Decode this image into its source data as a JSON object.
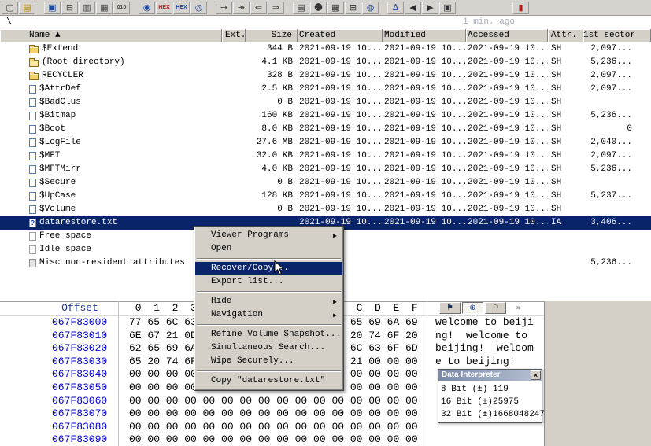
{
  "toolbar": {
    "buttons": [
      {
        "n": "new-file-button",
        "g": "▢",
        "cls": "",
        "it": "true"
      },
      {
        "n": "open-folder-button",
        "g": "▤",
        "cls": "gold",
        "it": "true"
      },
      {
        "n": "toolbar-gap",
        "g": "",
        "cls": "gap",
        "it": "false"
      },
      {
        "n": "save-button",
        "g": "▣",
        "cls": "blue",
        "it": "true"
      },
      {
        "n": "copy-button",
        "g": "⊟",
        "cls": "",
        "it": "true"
      },
      {
        "n": "paste-button",
        "g": "▥",
        "cls": "",
        "it": "true"
      },
      {
        "n": "paste-into-new-button",
        "g": "▦",
        "cls": "",
        "it": "true"
      },
      {
        "n": "binary-010-button",
        "g": "010",
        "cls": "txt",
        "it": "true"
      },
      {
        "n": "toolbar-gap",
        "g": "",
        "cls": "gap",
        "it": "false"
      },
      {
        "n": "find-text-button",
        "g": "◉",
        "cls": "blue",
        "it": "true"
      },
      {
        "n": "find-hex-button",
        "g": "HEX",
        "cls": "txt red",
        "it": "true"
      },
      {
        "n": "replace-hex-button",
        "g": "HEX",
        "cls": "txt blue",
        "it": "true"
      },
      {
        "n": "find-next-button",
        "g": "◎",
        "cls": "blue",
        "it": "true"
      },
      {
        "n": "toolbar-gap",
        "g": "",
        "cls": "gap",
        "it": "false"
      },
      {
        "n": "goto-offset-button",
        "g": "→",
        "cls": "",
        "it": "true"
      },
      {
        "n": "goto-end-button",
        "g": "↠",
        "cls": "",
        "it": "true"
      },
      {
        "n": "back-button",
        "g": "⇐",
        "cls": "",
        "it": "true"
      },
      {
        "n": "forward-button",
        "g": "⇒",
        "cls": "",
        "it": "true"
      },
      {
        "n": "toolbar-gap",
        "g": "",
        "cls": "gap",
        "it": "false"
      },
      {
        "n": "print-button",
        "g": "▤",
        "cls": "dark",
        "it": "true"
      },
      {
        "n": "users-button",
        "g": "☻",
        "cls": "dark",
        "it": "true"
      },
      {
        "n": "notes-button",
        "g": "▦",
        "cls": "dark",
        "it": "true"
      },
      {
        "n": "calculator-button",
        "g": "⊞",
        "cls": "dark",
        "it": "true"
      },
      {
        "n": "magnifier-button",
        "g": "◍",
        "cls": "blue",
        "it": "true"
      },
      {
        "n": "toolbar-gap",
        "g": "",
        "cls": "gap",
        "it": "false"
      },
      {
        "n": "scales-button",
        "g": "Δ",
        "cls": "blue",
        "it": "true"
      },
      {
        "n": "prev-button",
        "g": "◀",
        "cls": "dark",
        "it": "true"
      },
      {
        "n": "next-button",
        "g": "▶",
        "cls": "dark",
        "it": "true"
      },
      {
        "n": "camera-button",
        "g": "▣",
        "cls": "dark",
        "it": "true"
      },
      {
        "n": "toolbar-gap-wide",
        "g": "",
        "cls": "gapw",
        "it": "false"
      },
      {
        "n": "help-book-button",
        "g": "▮",
        "cls": "red",
        "it": "true"
      }
    ]
  },
  "pathbar": {
    "path": "\\",
    "age_label": "1 min. ago"
  },
  "file_table": {
    "columns": [
      "Name ▲",
      "Ext.",
      "Size",
      "Created",
      "Modified",
      "Accessed",
      "Attr.",
      "1st sector"
    ],
    "rows": [
      {
        "icon_cls": "icon-folder",
        "icon_name": "folder-icon",
        "icon_glyph": "",
        "name": "$Extend",
        "ext": "",
        "size": "344 B",
        "created": "2021-09-19 10...",
        "modified": "2021-09-19 10...",
        "accessed": "2021-09-19 10...",
        "attr": "SH",
        "sector": "2,097...",
        "cls": ""
      },
      {
        "icon_cls": "icon-folder-open",
        "icon_name": "open-folder-icon",
        "icon_glyph": "",
        "name": "(Root directory)",
        "ext": "",
        "size": "4.1 KB",
        "created": "2021-09-19 10...",
        "modified": "2021-09-19 10...",
        "accessed": "2021-09-19 10...",
        "attr": "SH",
        "sector": "5,236...",
        "cls": ""
      },
      {
        "icon_cls": "icon-folder",
        "icon_name": "folder-icon",
        "icon_glyph": "",
        "name": "RECYCLER",
        "ext": "",
        "size": "328 B",
        "created": "2021-09-19 10...",
        "modified": "2021-09-19 10...",
        "accessed": "2021-09-19 10...",
        "attr": "SH",
        "sector": "2,097...",
        "cls": ""
      },
      {
        "icon_cls": "icon-file",
        "icon_name": "system-file-icon",
        "icon_glyph": "",
        "name": "$AttrDef",
        "ext": "",
        "size": "2.5 KB",
        "created": "2021-09-19 10...",
        "modified": "2021-09-19 10...",
        "accessed": "2021-09-19 10...",
        "attr": "SH",
        "sector": "2,097...",
        "cls": ""
      },
      {
        "icon_cls": "icon-file",
        "icon_name": "system-file-icon",
        "icon_glyph": "",
        "name": "$BadClus",
        "ext": "",
        "size": "0 B",
        "created": "2021-09-19 10...",
        "modified": "2021-09-19 10...",
        "accessed": "2021-09-19 10...",
        "attr": "SH",
        "sector": "",
        "cls": ""
      },
      {
        "icon_cls": "icon-file",
        "icon_name": "system-file-icon",
        "icon_glyph": "",
        "name": "$Bitmap",
        "ext": "",
        "size": "160 KB",
        "created": "2021-09-19 10...",
        "modified": "2021-09-19 10...",
        "accessed": "2021-09-19 10...",
        "attr": "SH",
        "sector": "5,236...",
        "cls": ""
      },
      {
        "icon_cls": "icon-file",
        "icon_name": "system-file-icon",
        "icon_glyph": "",
        "name": "$Boot",
        "ext": "",
        "size": "8.0 KB",
        "created": "2021-09-19 10...",
        "modified": "2021-09-19 10...",
        "accessed": "2021-09-19 10...",
        "attr": "SH",
        "sector": "0",
        "cls": ""
      },
      {
        "icon_cls": "icon-file",
        "icon_name": "system-file-icon",
        "icon_glyph": "",
        "name": "$LogFile",
        "ext": "",
        "size": "27.6 MB",
        "created": "2021-09-19 10...",
        "modified": "2021-09-19 10...",
        "accessed": "2021-09-19 10...",
        "attr": "SH",
        "sector": "2,040...",
        "cls": ""
      },
      {
        "icon_cls": "icon-file",
        "icon_name": "system-file-icon",
        "icon_glyph": "",
        "name": "$MFT",
        "ext": "",
        "size": "32.0 KB",
        "created": "2021-09-19 10...",
        "modified": "2021-09-19 10...",
        "accessed": "2021-09-19 10...",
        "attr": "SH",
        "sector": "2,097...",
        "cls": ""
      },
      {
        "icon_cls": "icon-file",
        "icon_name": "system-file-icon",
        "icon_glyph": "",
        "name": "$MFTMirr",
        "ext": "",
        "size": "4.0 KB",
        "created": "2021-09-19 10...",
        "modified": "2021-09-19 10...",
        "accessed": "2021-09-19 10...",
        "attr": "SH",
        "sector": "5,236...",
        "cls": ""
      },
      {
        "icon_cls": "icon-file",
        "icon_name": "system-file-icon",
        "icon_glyph": "",
        "name": "$Secure",
        "ext": "",
        "size": "0 B",
        "created": "2021-09-19 10...",
        "modified": "2021-09-19 10...",
        "accessed": "2021-09-19 10...",
        "attr": "SH",
        "sector": "",
        "cls": ""
      },
      {
        "icon_cls": "icon-file",
        "icon_name": "system-file-icon",
        "icon_glyph": "",
        "name": "$UpCase",
        "ext": "",
        "size": "128 KB",
        "created": "2021-09-19 10...",
        "modified": "2021-09-19 10...",
        "accessed": "2021-09-19 10...",
        "attr": "SH",
        "sector": "5,237...",
        "cls": ""
      },
      {
        "icon_cls": "icon-file",
        "icon_name": "system-file-icon",
        "icon_glyph": "",
        "name": "$Volume",
        "ext": "",
        "size": "0 B",
        "created": "2021-09-19 10...",
        "modified": "2021-09-19 10...",
        "accessed": "2021-09-19 10...",
        "attr": "SH",
        "sector": "",
        "cls": ""
      },
      {
        "icon_cls": "icon-file-del",
        "icon_name": "deleted-file-icon",
        "icon_glyph": "?",
        "name": "datarestore.txt",
        "ext": "",
        "size": "",
        "created": "2021-09-19 10...",
        "modified": "2021-09-19 10...",
        "accessed": "2021-09-19 10...",
        "attr": "IA",
        "sector": "3,406...",
        "cls": "selected"
      },
      {
        "icon_cls": "icon-space",
        "icon_name": "free-space-icon",
        "icon_glyph": "",
        "name": "Free space",
        "ext": "",
        "size": "",
        "created": "",
        "modified": "",
        "accessed": "",
        "attr": "",
        "sector": "",
        "cls": ""
      },
      {
        "icon_cls": "icon-space",
        "icon_name": "idle-space-icon",
        "icon_glyph": "",
        "name": "Idle space",
        "ext": "",
        "size": "",
        "created": "",
        "modified": "",
        "accessed": "",
        "attr": "",
        "sector": "",
        "cls": ""
      },
      {
        "icon_cls": "icon-file-gray",
        "icon_name": "misc-attributes-icon",
        "icon_glyph": "",
        "name": "Misc non-resident attributes",
        "ext": "",
        "size": "",
        "created": "",
        "modified": "",
        "accessed": "",
        "attr": "",
        "sector": "5,236...",
        "cls": ""
      }
    ]
  },
  "context_menu": {
    "submenu_arrow": "▶",
    "items": [
      {
        "label": "Viewer Programs"
      },
      {
        "label": "Open"
      },
      {
        "label": "Recover/Copy..."
      },
      {
        "label": "Export list..."
      },
      {
        "label": "Hide"
      },
      {
        "label": "Navigation"
      },
      {
        "label": "Refine Volume Snapshot..."
      },
      {
        "label": "Simultaneous Search..."
      },
      {
        "label": "Wipe Securely..."
      },
      {
        "label": "Copy \"datarestore.txt\""
      }
    ]
  },
  "hex_panel": {
    "header": {
      "offset_label": "Offset",
      "columns": " 0  1  2  3  4  5  6  7  8  9  A  B  C  D  E  F"
    },
    "rows": [
      {
        "offset": "067F83000",
        "bytes": "77 65 6C 63 6F 6D 65 20 74 6F 20 62 65 69 6A 69",
        "text": "welcome to beiji"
      },
      {
        "offset": "067F83010",
        "bytes": "6E 67 21 0D 0A 77 65 6C 63 6F 6D 65 20 74 6F 20",
        "text": "ng!  welcome to "
      },
      {
        "offset": "067F83020",
        "bytes": "62 65 69 6A 69 6E 67 21 0D 0A 77 65 6C 63 6F 6D",
        "text": "beijing!  welcom"
      },
      {
        "offset": "067F83030",
        "bytes": "65 20 74 6F 20 62 65 69 6A 69 6E 67 21 00 00 00",
        "text": "e to beijing!"
      },
      {
        "offset": "067F83040",
        "bytes": "00 00 00 00 00 00 00 00 00 00 00 00 00 00 00 00",
        "text": ""
      },
      {
        "offset": "067F83050",
        "bytes": "00 00 00 00 00 00 00 00 00 00 00 00 00 00 00 00",
        "text": ""
      },
      {
        "offset": "067F83060",
        "bytes": "00 00 00 00 00 00 00 00 00 00 00 00 00 00 00 00",
        "text": ""
      },
      {
        "offset": "067F83070",
        "bytes": "00 00 00 00 00 00 00 00 00 00 00 00 00 00 00 00",
        "text": ""
      },
      {
        "offset": "067F83080",
        "bytes": "00 00 00 00 00 00 00 00 00 00 00 00 00 00 00 00",
        "text": ""
      },
      {
        "offset": "067F83090",
        "bytes": "00 00 00 00 00 00 00 00 00 00 00 00 00 00 00 00",
        "text": ""
      }
    ]
  },
  "preview_toolbar": {
    "buttons": [
      {
        "glyph": "⚑"
      },
      {
        "glyph": "⊕"
      },
      {
        "glyph": "⚐"
      },
      {
        "glyph": "»"
      }
    ]
  },
  "data_interpreter": {
    "title": "Data Interpreter",
    "close_glyph": "×",
    "rows": [
      {
        "label": "8 Bit (±)",
        "value": "119"
      },
      {
        "label": "16 Bit (±)",
        "value": "25975"
      },
      {
        "label": "32 Bit (±)",
        "value": "1668048247"
      }
    ]
  }
}
